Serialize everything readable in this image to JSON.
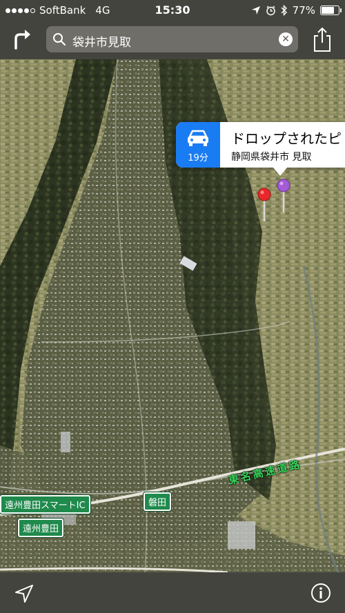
{
  "status_bar": {
    "carrier": "SoftBank",
    "network": "4G",
    "signal_bars": 4,
    "time": "15:30",
    "battery": "77%",
    "battery_level": 0.77,
    "icons": [
      "location-arrow-icon",
      "alarm-icon",
      "bluetooth-icon"
    ]
  },
  "top_bar": {
    "directions_icon": "turn-right-arrow-icon",
    "search_query": "袋井市見取",
    "search_icon": "search-icon",
    "clear_icon": "clear-icon",
    "share_icon": "share-icon"
  },
  "callout": {
    "mode_icon": "car-icon",
    "travel_time": "19分",
    "title": "ドロップされたピ",
    "subtitle": "静岡県袋井市 見取"
  },
  "pins": [
    {
      "name": "red-pin",
      "color": "#e8282a"
    },
    {
      "name": "purple-pin",
      "color": "#a35bd6"
    }
  ],
  "map_labels": {
    "expressway": "東名高速道路",
    "smart_ic": "遠州豊田スマートIC",
    "iwata": "磐田",
    "enshu_toyoda": "遠州豊田"
  },
  "bottom_bar": {
    "location_icon": "location-arrow-icon",
    "info_icon": "info-icon"
  },
  "colors": {
    "accent_blue": "#1a7cf3",
    "bar_bg": "#46463f",
    "expressway_label": "#38d45a",
    "sign_green": "#1f8a4c"
  }
}
